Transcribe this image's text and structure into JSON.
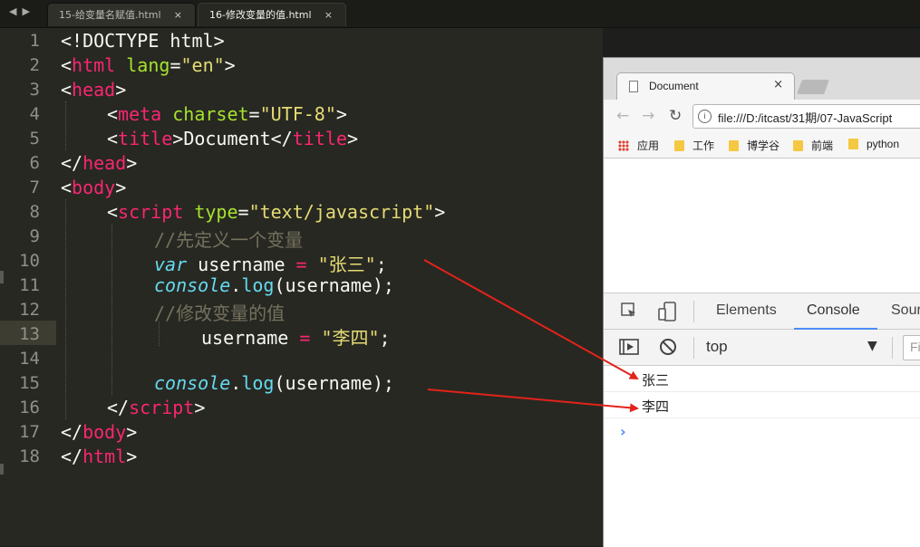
{
  "editor": {
    "tabs": [
      {
        "label": "15-给变量名赋值.html",
        "close": "×"
      },
      {
        "label": "16-修改变量的值.html",
        "close": "×"
      }
    ],
    "lines": {
      "l1": {
        "doctype": "<!DOCTYPE html>"
      },
      "l2": {
        "lt": "<",
        "tag": "html",
        "attr": " lang",
        "eq": "=",
        "val": "\"en\"",
        "gt": ">"
      },
      "l3": {
        "lt": "<",
        "tag": "head",
        "gt": ">"
      },
      "l4": {
        "lt": "<",
        "tag": "meta",
        "attr": " charset",
        "eq": "=",
        "val": "\"UTF-8\"",
        "gt": ">"
      },
      "l5": {
        "lt1": "<",
        "tag1": "title",
        "gt1": ">",
        "text": "Document",
        "lt2": "</",
        "tag2": "title",
        "gt2": ">"
      },
      "l6": {
        "lt": "</",
        "tag": "head",
        "gt": ">"
      },
      "l7": {
        "lt": "<",
        "tag": "body",
        "gt": ">"
      },
      "l8": {
        "lt": "<",
        "tag": "script",
        "attr": " type",
        "eq": "=",
        "val": "\"text/javascript\"",
        "gt": ">"
      },
      "l9": {
        "comment": "//先定义一个变量"
      },
      "l10": {
        "kw": "var",
        "name": " username ",
        "op": "=",
        "val": " \"张三\"",
        "semi": ";"
      },
      "l11": {
        "obj": "console",
        "dot": ".",
        "fn": "log",
        "args": "(username);"
      },
      "l12": {
        "comment": "//修改变量的值"
      },
      "l13": {
        "name": "username ",
        "op": "=",
        "val": " \"李四\"",
        "semi": ";"
      },
      "l15": {
        "obj": "console",
        "dot": ".",
        "fn": "log",
        "args": "(username);"
      },
      "l16": {
        "lt": "</",
        "tag": "script",
        "gt": ">"
      },
      "l17": {
        "lt": "</",
        "tag": "body",
        "gt": ">"
      },
      "l18": {
        "lt": "</",
        "tag": "html",
        "gt": ">"
      }
    },
    "line_numbers": [
      "1",
      "2",
      "3",
      "4",
      "5",
      "6",
      "7",
      "8",
      "9",
      "10",
      "11",
      "12",
      "13",
      "14",
      "15",
      "16",
      "17",
      "18"
    ]
  },
  "browser": {
    "tab_title": "Document",
    "tab_close": "×",
    "url": "file:///D:/itcast/31期/07-JavaScript",
    "bookmarks": [
      "应用",
      "工作",
      "博学谷",
      "前端",
      "python"
    ]
  },
  "devtools": {
    "tabs": [
      "Elements",
      "Console",
      "Sources"
    ],
    "context": "top",
    "filter_placeholder": "Filter",
    "console_output": [
      "张三",
      "李四"
    ],
    "prompt": "›"
  },
  "colors": {
    "annotation_arrow": "#e2231a",
    "accent": "#4c8df6"
  }
}
